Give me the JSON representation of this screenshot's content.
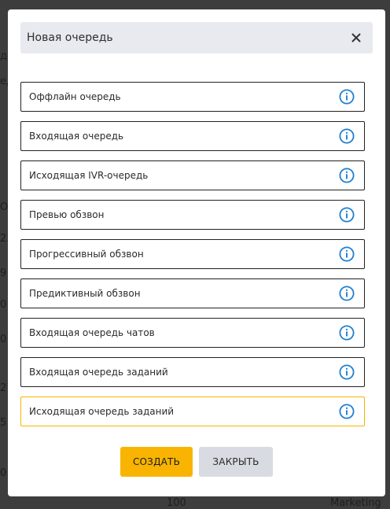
{
  "background": {
    "fragments": [
      "де",
      "ед",
      "О",
      "23",
      "9",
      "0",
      "0",
      "27",
      "5",
      "0",
      "100",
      "Marketing"
    ]
  },
  "modal": {
    "title": "Новая очередь",
    "close_icon": "close-icon",
    "options": [
      {
        "label": "Оффлайн очередь",
        "icon": "info-icon",
        "selected": false
      },
      {
        "label": "Входящая очередь",
        "icon": "info-icon",
        "selected": false
      },
      {
        "label": "Исходящая IVR-очередь",
        "icon": "info-icon",
        "selected": false
      },
      {
        "label": "Превью обзвон",
        "icon": "info-icon",
        "selected": false
      },
      {
        "label": "Прогрессивный обзвон",
        "icon": "info-icon",
        "selected": false
      },
      {
        "label": "Предиктивный обзвон",
        "icon": "info-icon",
        "selected": false
      },
      {
        "label": "Входящая очередь чатов",
        "icon": "info-icon",
        "selected": false
      },
      {
        "label": "Входящая очередь заданий",
        "icon": "info-icon",
        "selected": false
      },
      {
        "label": "Исходящая очередь заданий",
        "icon": "info-icon",
        "selected": true
      }
    ],
    "buttons": {
      "create_label": "СОЗДАТЬ",
      "close_label": "ЗАКРЫТЬ"
    }
  },
  "colors": {
    "accent": "#f8b400",
    "info_icon": "#1f7fd1",
    "header_bg": "#e8eaf0"
  }
}
